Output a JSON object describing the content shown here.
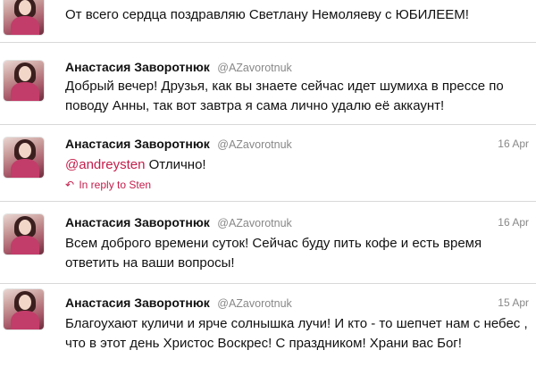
{
  "tweets": [
    {
      "name": "",
      "handle": "",
      "date": "",
      "text": "От всего сердца поздравляю Светлану Немоляеву с ЮБИЛЕЕМ!"
    },
    {
      "name": "Анастасия Заворотнюк",
      "handle": "@AZavorotnuk",
      "date": "",
      "text": "Добрый вечер! Друзья, как вы знаете сейчас идет шумиха в прессе по поводу Анны, так вот завтра я сама лично удалю её аккаунт!"
    },
    {
      "name": "Анастасия Заворотнюк",
      "handle": "@AZavorotnuk",
      "date": "16 Apr",
      "mention": "@andreysten",
      "text": "Отлично!",
      "reply": "In reply to Sten"
    },
    {
      "name": "Анастасия Заворотнюк",
      "handle": "@AZavorotnuk",
      "date": "16 Apr",
      "text": "Всем доброго времени суток! Сейчас буду пить кофе и есть время ответить на ваши вопросы!"
    },
    {
      "name": "Анастасия Заворотнюк",
      "handle": "@AZavorotnuk",
      "date": "15 Apr",
      "text": "Благоухают куличи и ярче солнышка лучи! И кто - то шепчет нам с небес , что в этот день Христос Воскрес! С праздником! Храни вас Бог!"
    }
  ]
}
